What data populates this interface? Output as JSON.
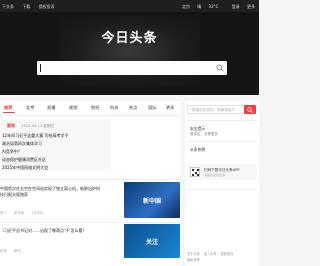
{
  "topbar": {
    "left_items": [
      "下头条",
      "下载",
      "侵权投诉"
    ],
    "location": "北京",
    "weather_sun": "晴",
    "temperature": "32°C",
    "login": "登录",
    "settings": "更多"
  },
  "hero": {
    "title": "今日头条",
    "search_value": ""
  },
  "tabs": [
    {
      "label": "推荐",
      "active": true
    },
    {
      "label": "北京",
      "active": false
    },
    {
      "label": "直播",
      "active": false
    },
    {
      "label": "视频",
      "active": false
    },
    {
      "label": "财经",
      "active": false
    },
    {
      "label": "科技",
      "active": false
    },
    {
      "label": "热点",
      "active": false
    },
    {
      "label": "国际",
      "active": false
    },
    {
      "label": "更多",
      "active": false
    }
  ],
  "hot": {
    "title": "要闻",
    "date": "2024-06-13 星期四",
    "items": [
      "12年间习近平这重大事 写给高考学子",
      "政治局第四次集体学习",
      "AI竞争中？",
      "动态保护健康消费区社区",
      "2025年中国网络文明大会"
    ]
  },
  "feed": [
    {
      "text": "中国首次在太空在空间站实现了独立离心机，新鲜出炉科",
      "text2": "技日报头版独家",
      "meta": [
        "热门",
        "新华网",
        "1万评论"
      ],
      "thumb_caption": "新中国"
    },
    {
      "text": "（习近平总书记对……出现了哪两点‘不’怎么看？",
      "meta": [
        "科技",
        "报刊"
      ],
      "thumb_caption": "关注"
    }
  ],
  "right": {
    "search_placeholder": "搜索站内资讯、视频或用户",
    "links": [
      "头条热榜",
      "安全提示",
      "登录后，查看更多"
    ],
    "section": "头条热榜",
    "app_title": "扫码下载今日头条APP",
    "app_sub": "有趣的发现更多",
    "footer": [
      "关于头条",
      "加入头条",
      "侵权投诉",
      "隐私政策"
    ]
  },
  "colors": {
    "accent": "#f04142",
    "hero_bg": "#151515",
    "topbar_bg": "#1f1f1f"
  }
}
